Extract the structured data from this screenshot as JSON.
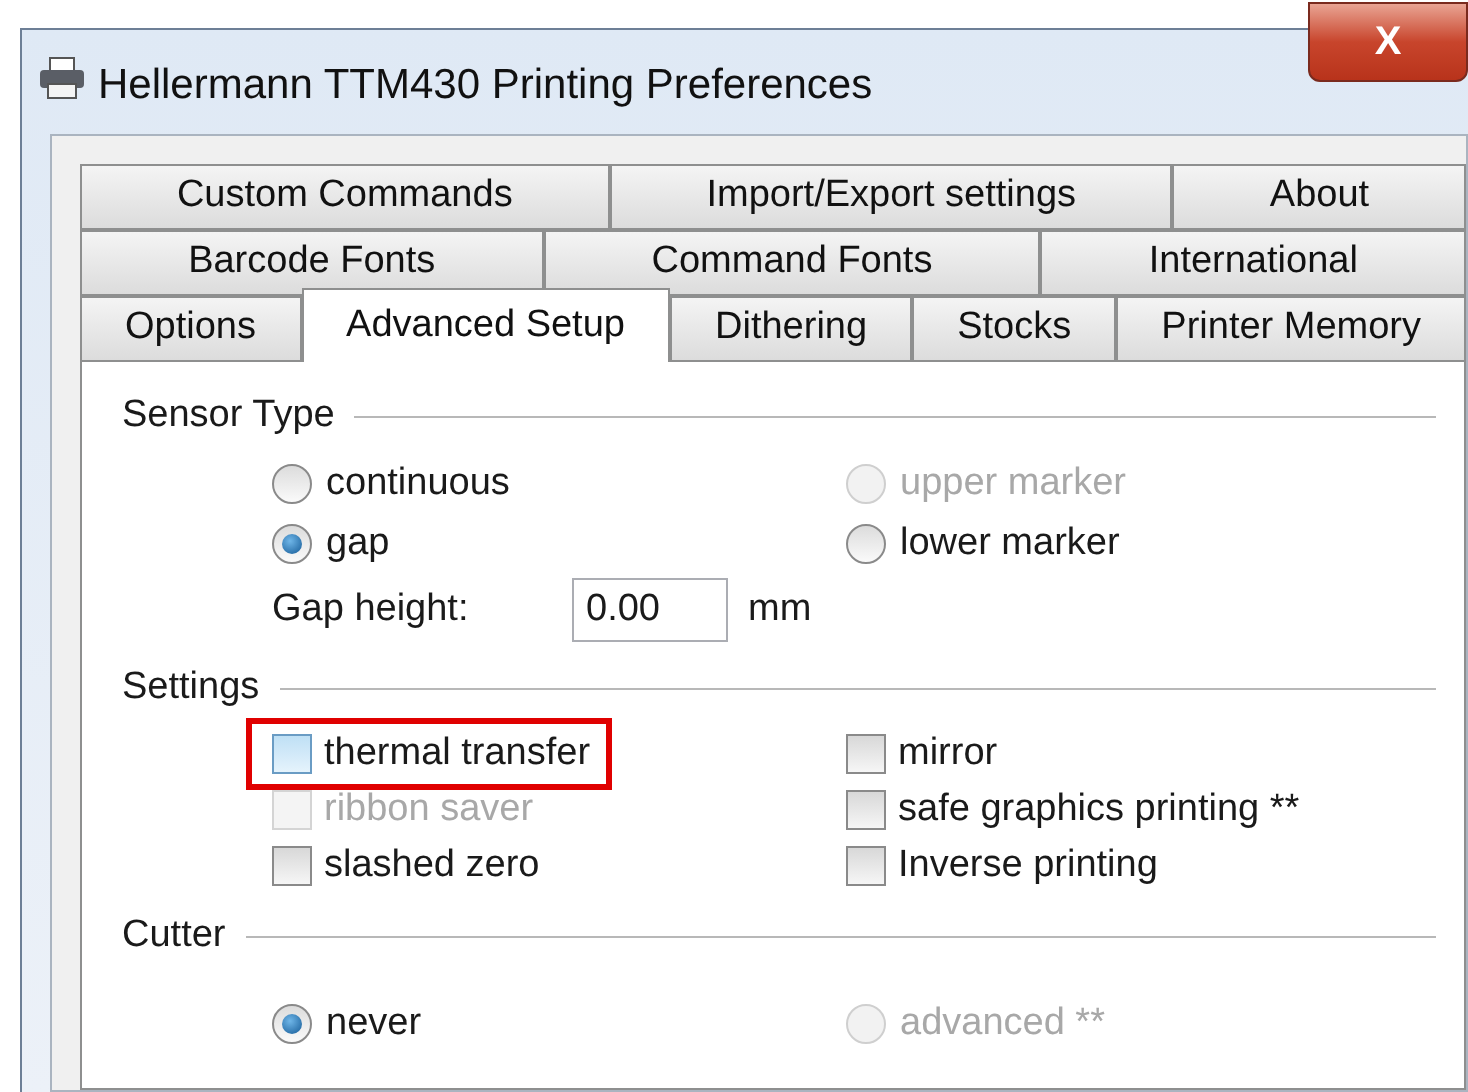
{
  "window": {
    "title": "Hellermann TTM430 Printing Preferences",
    "close": "X"
  },
  "tab_rows": [
    {
      "tabs": [
        {
          "label": "Custom Commands",
          "selected": false
        },
        {
          "label": "Import/Export settings",
          "selected": false
        },
        {
          "label": "About",
          "selected": false
        }
      ]
    },
    {
      "tabs": [
        {
          "label": "Barcode Fonts",
          "selected": false
        },
        {
          "label": "Command Fonts",
          "selected": false
        },
        {
          "label": "International",
          "selected": false
        }
      ]
    },
    {
      "tabs": [
        {
          "label": "Options",
          "selected": false
        },
        {
          "label": "Advanced Setup",
          "selected": true
        },
        {
          "label": "Dithering",
          "selected": false
        },
        {
          "label": "Stocks",
          "selected": false
        },
        {
          "label": "Printer Memory",
          "selected": false
        }
      ]
    }
  ],
  "sections": [
    {
      "title": "Sensor Type",
      "items": [
        {
          "kind": "radio",
          "label": "continuous",
          "selected": false,
          "disabled": false
        },
        {
          "kind": "radio",
          "label": "upper marker",
          "selected": false,
          "disabled": true
        },
        {
          "kind": "radio",
          "label": "gap",
          "selected": true,
          "disabled": false
        },
        {
          "kind": "radio",
          "label": "lower marker",
          "selected": false,
          "disabled": false
        },
        {
          "kind": "field",
          "label": "Gap height:",
          "value": "0.00",
          "unit": "mm"
        }
      ]
    },
    {
      "title": "Settings",
      "items": [
        {
          "kind": "checkbox",
          "label": "thermal transfer",
          "checked": false,
          "disabled": false,
          "highlighted": true
        },
        {
          "kind": "checkbox",
          "label": "mirror",
          "checked": false,
          "disabled": false,
          "highlighted": false
        },
        {
          "kind": "checkbox",
          "label": "ribbon saver",
          "checked": false,
          "disabled": true,
          "highlighted": false
        },
        {
          "kind": "checkbox",
          "label": "safe graphics printing **",
          "checked": false,
          "disabled": false,
          "highlighted": false
        },
        {
          "kind": "checkbox",
          "label": "slashed zero",
          "checked": false,
          "disabled": false,
          "highlighted": false
        },
        {
          "kind": "checkbox",
          "label": "Inverse printing",
          "checked": false,
          "disabled": false,
          "highlighted": false
        }
      ]
    },
    {
      "title": "Cutter",
      "items": [
        {
          "kind": "radio",
          "label": "never",
          "selected": true,
          "disabled": false
        },
        {
          "kind": "radio",
          "label": "advanced **",
          "selected": false,
          "disabled": true
        }
      ]
    }
  ]
}
